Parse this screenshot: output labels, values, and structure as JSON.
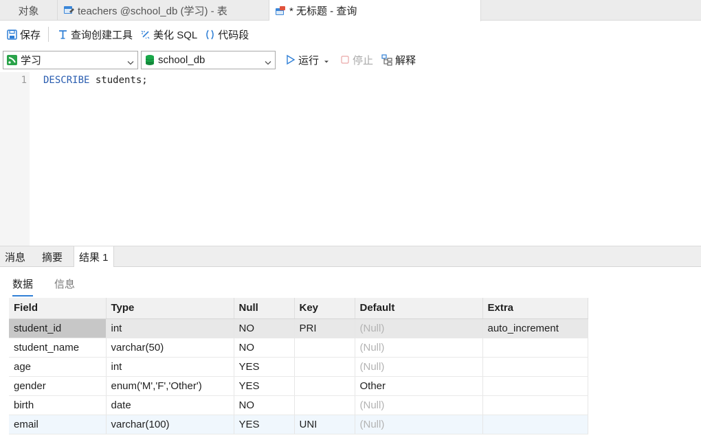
{
  "tabs": [
    {
      "label": "对象"
    },
    {
      "label": "teachers @school_db (学习) - 表"
    },
    {
      "label": "* 无标题 - 查询"
    }
  ],
  "toolbar": {
    "save": "保存",
    "query_builder": "查询创建工具",
    "beautify": "美化 SQL",
    "snippet": "代码段"
  },
  "connection": {
    "selected": "学习"
  },
  "database": {
    "selected": "school_db"
  },
  "actions": {
    "run": "运行",
    "stop": "停止",
    "explain": "解释"
  },
  "editor": {
    "line_number": "1",
    "keyword": "DESCRIBE",
    "rest": " students;"
  },
  "result_tabs": [
    {
      "label": "消息"
    },
    {
      "label": "摘要"
    },
    {
      "label": "结果 1"
    }
  ],
  "sub_tabs": [
    {
      "label": "数据"
    },
    {
      "label": "信息"
    }
  ],
  "columns": [
    "Field",
    "Type",
    "Null",
    "Key",
    "Default",
    "Extra"
  ],
  "rows": [
    [
      "student_id",
      "int",
      "NO",
      "PRI",
      "(Null)",
      "auto_increment"
    ],
    [
      "student_name",
      "varchar(50)",
      "NO",
      "",
      "(Null)",
      ""
    ],
    [
      "age",
      "int",
      "YES",
      "",
      "(Null)",
      ""
    ],
    [
      "gender",
      "enum('M','F','Other')",
      "YES",
      "",
      "Other",
      ""
    ],
    [
      "birth",
      "date",
      "NO",
      "",
      "(Null)",
      ""
    ],
    [
      "email",
      "varchar(100)",
      "YES",
      "UNI",
      "(Null)",
      ""
    ]
  ],
  "colors": {
    "accent": "#2f7fd6",
    "keyword": "#2a5db0",
    "null_text": "#b3b3b3",
    "run_icon": "#2f7fd6",
    "db_icon": "#1aa84a"
  }
}
